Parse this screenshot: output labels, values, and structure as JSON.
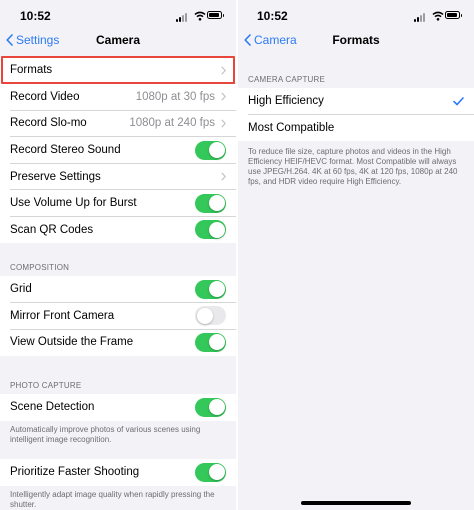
{
  "left": {
    "time": "10:52",
    "back_label": "Settings",
    "title": "Camera",
    "rows": [
      {
        "label": "Formats",
        "value": "",
        "accessory": "chevron"
      },
      {
        "label": "Record Video",
        "value": "1080p at 30 fps",
        "accessory": "chevron"
      },
      {
        "label": "Record Slo-mo",
        "value": "1080p at 240 fps",
        "accessory": "chevron"
      },
      {
        "label": "Record Stereo Sound",
        "value": "",
        "accessory": "toggle",
        "on": true
      },
      {
        "label": "Preserve Settings",
        "value": "",
        "accessory": "chevron"
      },
      {
        "label": "Use Volume Up for Burst",
        "value": "",
        "accessory": "toggle",
        "on": true
      },
      {
        "label": "Scan QR Codes",
        "value": "",
        "accessory": "toggle",
        "on": true
      }
    ],
    "composition": {
      "header": "COMPOSITION",
      "rows": [
        {
          "label": "Grid",
          "on": true
        },
        {
          "label": "Mirror Front Camera",
          "on": false
        },
        {
          "label": "View Outside the Frame",
          "on": true
        }
      ]
    },
    "photo_capture": {
      "header": "PHOTO CAPTURE",
      "scene_detection": {
        "label": "Scene Detection",
        "on": true
      },
      "scene_footer": "Automatically improve photos of various scenes using intelligent image recognition.",
      "prioritize": {
        "label": "Prioritize Faster Shooting",
        "on": true
      },
      "prioritize_footer": "Intelligently adapt image quality when rapidly pressing the shutter."
    }
  },
  "right": {
    "time": "10:52",
    "back_label": "Camera",
    "title": "Formats",
    "section_header": "CAMERA CAPTURE",
    "options": [
      {
        "label": "High Efficiency",
        "selected": true
      },
      {
        "label": "Most Compatible",
        "selected": false
      }
    ],
    "footer": "To reduce file size, capture photos and videos in the High Efficiency HEIF/HEVC format. Most Compatible will always use JPEG/H.264. 4K at 60 fps, 4K at 120 fps, 1080p at 240 fps, and HDR video require High Efficiency."
  },
  "colors": {
    "accent": "#2d7bf4",
    "toggle_on": "#34c759",
    "highlight": "#e8453c"
  }
}
